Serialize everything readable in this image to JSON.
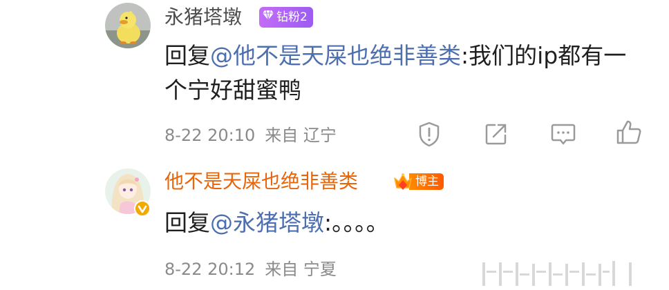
{
  "comments": [
    {
      "username": "永猪塔墩",
      "badge": {
        "label": "钻粉2",
        "icon": "diamond-icon"
      },
      "reply_prefix": "回复",
      "mention": "@他不是天屎也绝非善类",
      "text": ":我们的ip都有一个宁好甜蜜鸭",
      "date": "8-22 20:10",
      "location": "来自 辽宁"
    },
    {
      "username": "他不是天屎也绝非善类",
      "badge": {
        "label": "博主",
        "icon": "crown-icon"
      },
      "reply_prefix": "回复",
      "mention": "@永猪塔墩",
      "text": ":。。。。",
      "date": "8-22 20:12",
      "location": "来自 宁夏"
    }
  ],
  "actions": [
    "report-icon",
    "share-icon",
    "reply-icon",
    "like-icon"
  ],
  "colors": {
    "mention": "#4d6fb0",
    "blogger_name": "#e8650c",
    "meta": "#8a8a8a",
    "diamond_badge": "#b066f5",
    "blogger_badge": "#ff7a00"
  }
}
